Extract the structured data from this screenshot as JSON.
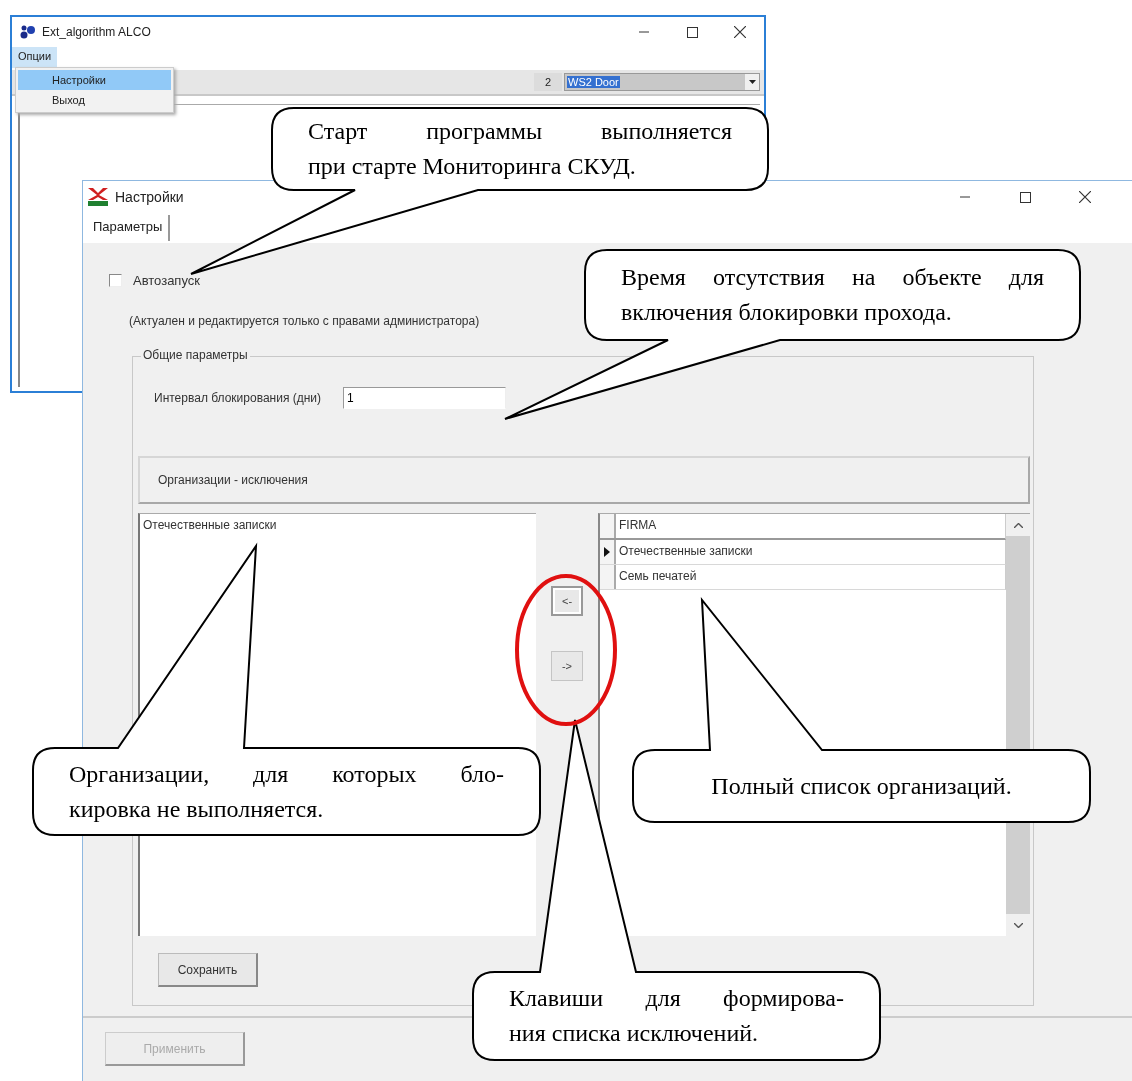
{
  "back_window": {
    "title": "Ext_algorithm ALCO",
    "menu": [
      {
        "label": "Опции",
        "selected": true
      }
    ],
    "dropdown": [
      {
        "label": "Настройки",
        "selected": true
      },
      {
        "label": "Выход",
        "selected": false
      }
    ],
    "toolbar": {
      "number": "2",
      "combo_value": "WS2 Door"
    }
  },
  "settings_window": {
    "title": "Настройки",
    "tabs": [
      {
        "label": "Параметры",
        "selected": true
      }
    ],
    "autostart": {
      "label": "Автозапуск",
      "checked": false
    },
    "note": "(Актуален и редактируется только с правами администратора)",
    "group": {
      "legend": "Общие параметры",
      "interval_label": "Интервал блокирования (дни)",
      "interval_value": "1",
      "exclusions_header": "Организации - исключения",
      "excluded": [
        "Отечественные записки"
      ],
      "move_buttons": [
        {
          "label": "<-",
          "focused": true
        },
        {
          "label": "->",
          "focused": false
        }
      ],
      "grid": {
        "columns": [
          "FIRMA"
        ],
        "rows": [
          {
            "cells": [
              "Отечественные записки"
            ],
            "selected": true
          },
          {
            "cells": [
              "Семь печатей"
            ],
            "selected": false
          }
        ]
      },
      "save_button": "Сохранить"
    },
    "apply_button": {
      "label": "Применить",
      "disabled": true
    }
  },
  "callouts": [
    {
      "lines": [
        "Старт программы выполняется",
        "при старте Мониторинга СКУД."
      ]
    },
    {
      "lines": [
        "Время отсутствия на объекте для",
        "включения блокировки прохода."
      ]
    },
    {
      "lines": [
        "Организации, для которых бло-",
        "кировка не выполняется."
      ]
    },
    {
      "lines": [
        "Полный список организаций."
      ]
    },
    {
      "lines": [
        "Клавиши для формирова-",
        "ния списка исключений."
      ]
    }
  ]
}
